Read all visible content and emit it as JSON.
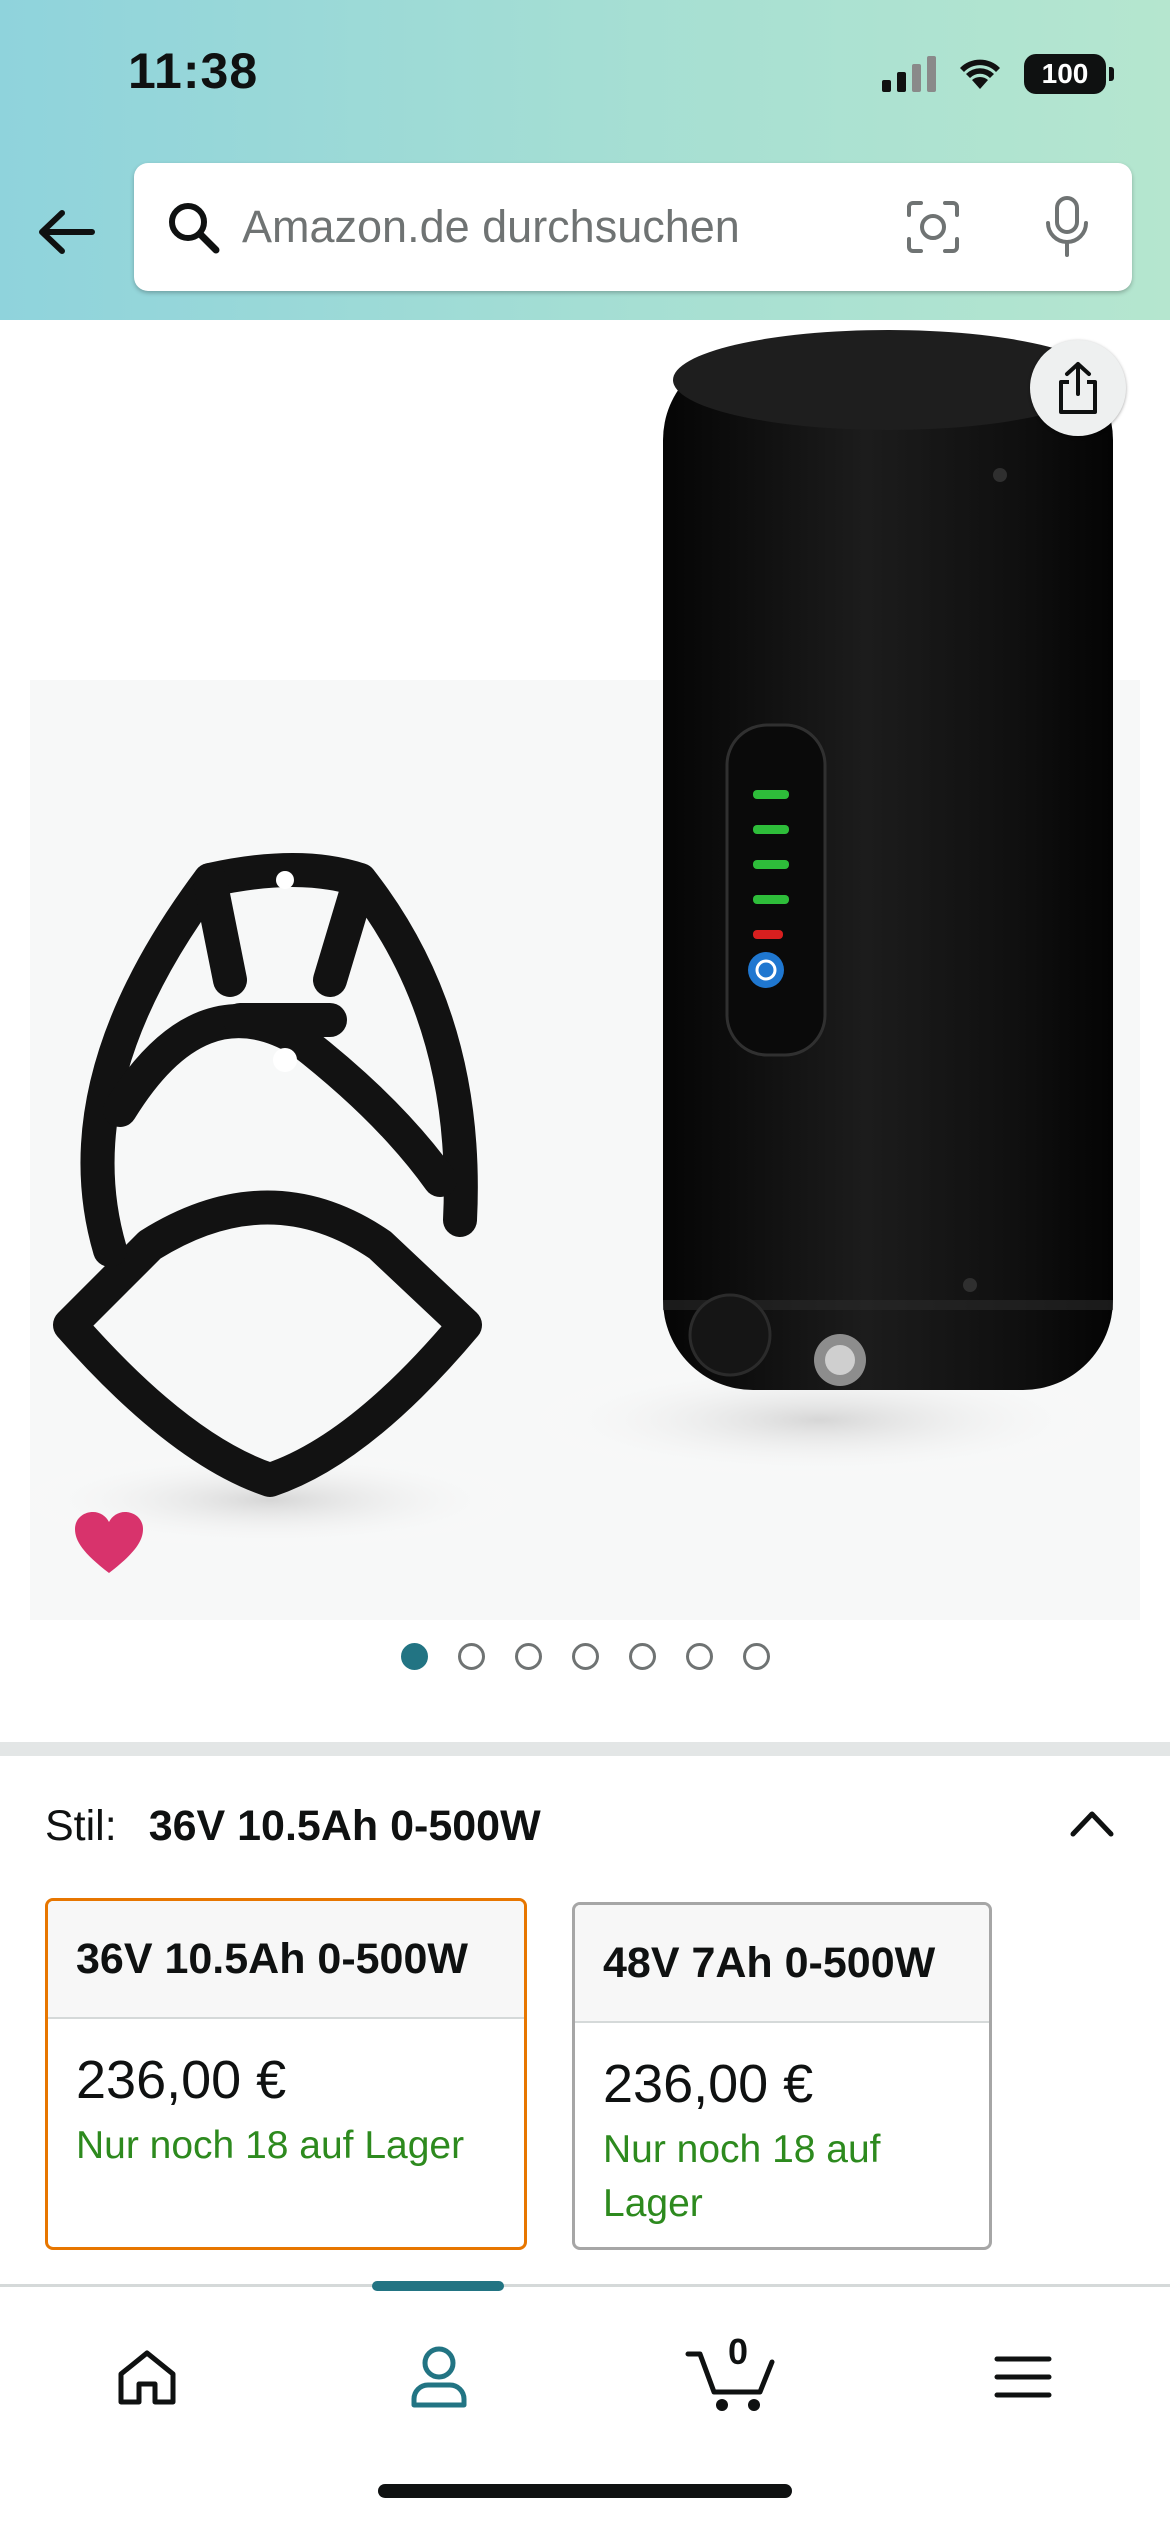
{
  "status_bar": {
    "time": "11:38",
    "battery": "100"
  },
  "search": {
    "placeholder": "Amazon.de durchsuchen",
    "value": ""
  },
  "carousel": {
    "total_images": 7,
    "active_index": 0
  },
  "style_selector": {
    "label": "Stil:",
    "selected_value": "36V 10.5Ah 0-500W",
    "options": [
      {
        "name": "36V 10.5Ah 0-500W",
        "price": "236,00 €",
        "stock": "Nur noch 18 auf Lager",
        "selected": true
      },
      {
        "name": "48V 7Ah 0-500W",
        "price": "236,00 €",
        "stock": "Nur noch 18 auf Lager",
        "selected": false
      }
    ]
  },
  "bottom_nav": {
    "items": [
      "home",
      "account",
      "cart",
      "menu"
    ],
    "active": "account",
    "cart_count": "0"
  },
  "colors": {
    "header_gradient_start": "#8fd3dc",
    "header_gradient_end": "#b5e6cf",
    "accent_teal": "#227483",
    "selected_border": "#e77600",
    "stock_green": "#2d8a1e",
    "heart_pink": "#d8336c"
  },
  "icons": {
    "back": "arrow-left-icon",
    "search": "magnifier-icon",
    "camera": "camera-lens-icon",
    "mic": "microphone-icon",
    "share": "share-icon",
    "wishlist": "heart-icon",
    "collapse": "chevron-up-icon",
    "home": "home-icon",
    "account": "person-icon",
    "cart": "cart-icon",
    "menu": "hamburger-icon"
  }
}
